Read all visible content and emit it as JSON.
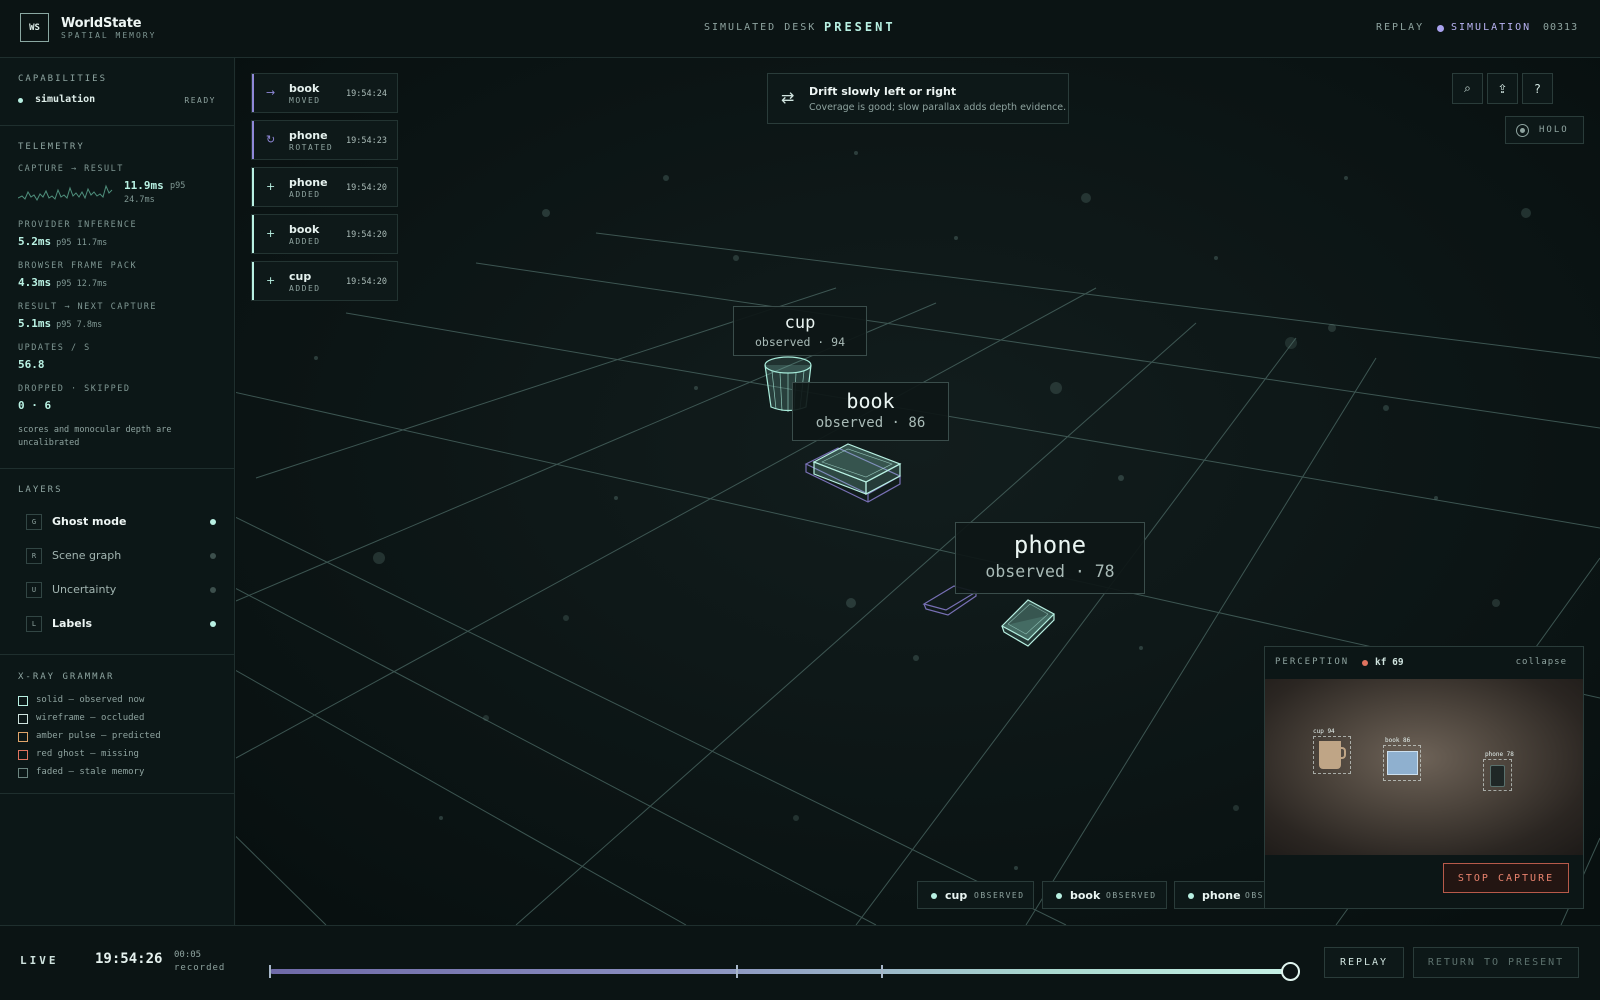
{
  "app": {
    "logo": "WS",
    "name": "WorldState",
    "subtitle": "SPATIAL MEMORY"
  },
  "header": {
    "scene_label": "SIMULATED DESK",
    "scene_state": "PRESENT",
    "replay_label": "REPLAY",
    "mode_label": "SIMULATION",
    "frame_counter": "00313",
    "mode_color": "#a9a2ee"
  },
  "capabilities": {
    "title": "CAPABILITIES",
    "items": [
      {
        "name": "simulation",
        "status": "READY"
      }
    ]
  },
  "telemetry": {
    "title": "TELEMETRY",
    "capture_result": {
      "label": "CAPTURE → RESULT",
      "value": "11.9ms",
      "p95_label": "p95",
      "p95_value": "24.7ms"
    },
    "provider_inference": {
      "label": "PROVIDER INFERENCE",
      "value": "5.2ms",
      "sub": "p95 11.7ms"
    },
    "browser_frame_pack": {
      "label": "BROWSER FRAME PACK",
      "value": "4.3ms",
      "sub": "p95 12.7ms"
    },
    "result_next_capture": {
      "label": "RESULT → NEXT CAPTURE",
      "value": "5.1ms",
      "sub": "p95 7.8ms"
    },
    "updates_per_s": {
      "label": "UPDATES / S",
      "value": "56.8"
    },
    "dropped_skipped": {
      "label": "DROPPED · SKIPPED",
      "value": "0 · 6"
    },
    "note_line1": "scores and monocular depth are",
    "note_line2": "uncalibrated"
  },
  "layers": {
    "title": "LAYERS",
    "items": [
      {
        "key": "G",
        "name": "Ghost mode",
        "enabled": true
      },
      {
        "key": "R",
        "name": "Scene graph",
        "enabled": false
      },
      {
        "key": "U",
        "name": "Uncertainty",
        "enabled": false
      },
      {
        "key": "L",
        "name": "Labels",
        "enabled": true
      }
    ]
  },
  "xray_grammar": {
    "title": "X-RAY GRAMMAR",
    "items": [
      {
        "text": "solid — observed now",
        "color": "#b8f0e2"
      },
      {
        "text": "wireframe — occluded",
        "color": "#cfe3de"
      },
      {
        "text": "amber pulse — predicted",
        "color": "#e0a56a"
      },
      {
        "text": "red ghost — missing",
        "color": "#e0735f"
      },
      {
        "text": "faded — stale memory",
        "color": "#6c8580"
      }
    ]
  },
  "events": [
    {
      "icon": "→",
      "object": "book",
      "action": "MOVED",
      "time": "19:54:24",
      "color": "#8f88d8"
    },
    {
      "icon": "↻",
      "object": "phone",
      "action": "ROTATED",
      "time": "19:54:23",
      "color": "#8f88d8"
    },
    {
      "icon": "+",
      "object": "phone",
      "action": "ADDED",
      "time": "19:54:20",
      "color": "#b8f0e2"
    },
    {
      "icon": "+",
      "object": "book",
      "action": "ADDED",
      "time": "19:54:20",
      "color": "#b8f0e2"
    },
    {
      "icon": "+",
      "object": "cup",
      "action": "ADDED",
      "time": "19:54:20",
      "color": "#b8f0e2"
    }
  ],
  "hint": {
    "icon": "⇄",
    "title": "Drift slowly left or right",
    "text": "Coverage is good; slow parallax adds depth evidence."
  },
  "toolbar": {
    "search_icon": "⌕",
    "share_icon": "⇪",
    "help_icon": "?",
    "holo_label": "HOLO"
  },
  "objects": [
    {
      "name": "cup",
      "state": "observed · 94"
    },
    {
      "name": "book",
      "state": "observed · 86"
    },
    {
      "name": "phone",
      "state": "observed · 78"
    }
  ],
  "chips": [
    {
      "name": "cup",
      "state": "OBSERVED"
    },
    {
      "name": "book",
      "state": "OBSERVED"
    },
    {
      "name": "phone",
      "state": "OBS"
    }
  ],
  "perception": {
    "title": "PERCEPTION",
    "keyframe": "kf 69",
    "collapse_label": "collapse",
    "detections": [
      {
        "label": "cup 94"
      },
      {
        "label": "book 86"
      },
      {
        "label": "phone 78"
      }
    ],
    "stop_label": "STOP CAPTURE"
  },
  "footer": {
    "live_label": "LIVE",
    "clock": "19:54:26",
    "recorded_duration": "00:05",
    "recorded_label": "recorded",
    "timeline_position": 1.0,
    "timeline_markers": [
      0.0,
      0.453,
      0.594
    ],
    "replay_label": "REPLAY",
    "return_label": "RETURN TO PRESENT"
  }
}
